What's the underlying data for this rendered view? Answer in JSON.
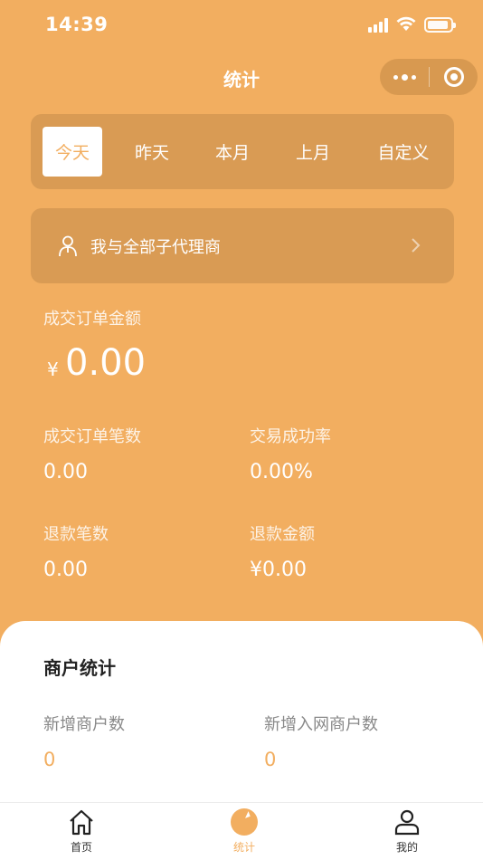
{
  "status_bar": {
    "time": "14:39"
  },
  "nav": {
    "title": "统计"
  },
  "date_tabs": [
    {
      "label": "今天",
      "active": true
    },
    {
      "label": "昨天",
      "active": false
    },
    {
      "label": "本月",
      "active": false
    },
    {
      "label": "上月",
      "active": false
    },
    {
      "label": "自定义",
      "active": false
    }
  ],
  "agent_selector": {
    "label": "我与全部子代理商",
    "icon": "person-icon"
  },
  "summary": {
    "amount_label": "成交订单金额",
    "currency_symbol": "¥",
    "amount_value": "0.00",
    "order_count_label": "成交订单笔数",
    "order_count_value": "0.00",
    "success_rate_label": "交易成功率",
    "success_rate_value": "0.00%",
    "refund_count_label": "退款笔数",
    "refund_count_value": "0.00",
    "refund_amount_label": "退款金额",
    "refund_amount_value": "¥0.00"
  },
  "merchant_stats": {
    "title": "商户统计",
    "new_merchants_label": "新增商户数",
    "new_merchants_value": "0",
    "new_network_merchants_label": "新增入网商户数",
    "new_network_merchants_value": "0"
  },
  "tab_bar": [
    {
      "label": "首页",
      "icon": "home-icon",
      "active": false
    },
    {
      "label": "统计",
      "icon": "stats-icon",
      "active": true
    },
    {
      "label": "我的",
      "icon": "profile-icon",
      "active": false
    }
  ],
  "colors": {
    "primary": "#f2ae60",
    "card": "#d99b54",
    "panel": "#ffffff"
  }
}
